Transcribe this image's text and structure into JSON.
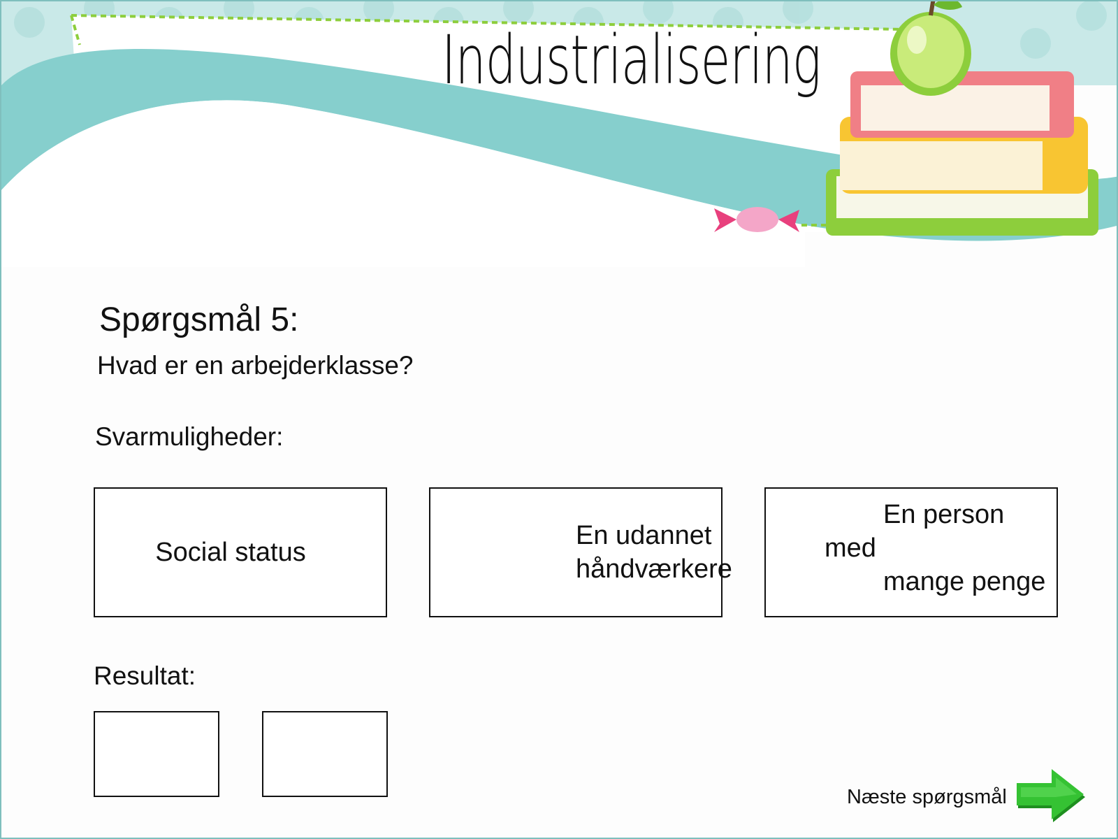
{
  "title": "Industrialisering",
  "question": {
    "label": "Spørgsmål 5:",
    "text": "Hvad er en arbejderklasse?"
  },
  "answers": {
    "label": "Svarmuligheder:",
    "options": [
      {
        "line1": "Social status",
        "line2": ""
      },
      {
        "line1": "En udannet",
        "line2": "håndværkere"
      },
      {
        "line1": "En person med",
        "line2": "mange penge"
      }
    ]
  },
  "result": {
    "label": "Resultat:",
    "slots": [
      "",
      ""
    ]
  },
  "navigation": {
    "next_label": "Næste spørgsmål",
    "next_icon": "green-arrow-right-icon"
  },
  "colors": {
    "teal": "#86cfcd",
    "teal_light": "#c9e9e8",
    "apple_green": "#8dce3c",
    "book_red": "#f07f86",
    "book_yellow": "#f8c532",
    "arrow_green": "#35c233"
  }
}
